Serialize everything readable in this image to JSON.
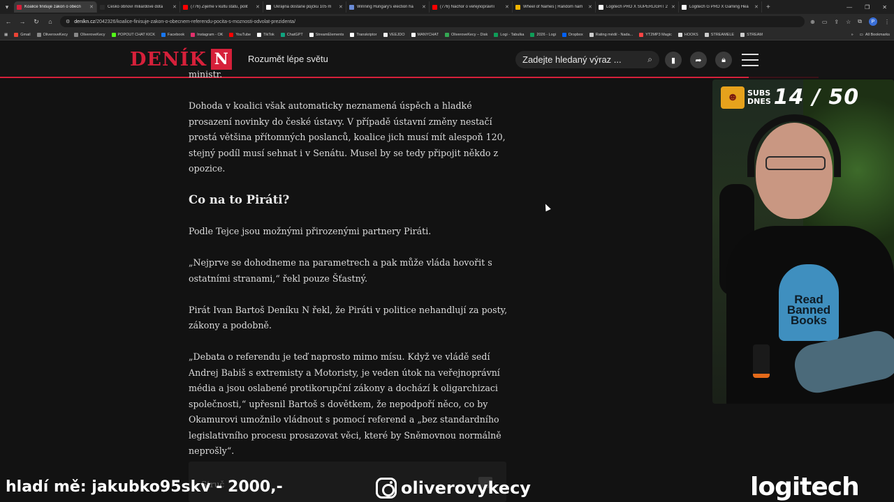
{
  "browser": {
    "tabs": [
      {
        "label": "Koalice finišuje zákon o obecn",
        "color": "#d6203a",
        "active": true
      },
      {
        "label": "Česko obnoví miliardové dota",
        "color": "#2b2b2b",
        "active": false
      },
      {
        "label": "(776) Žijeme v kultu státu, polit",
        "color": "#ff0000",
        "active": false
      },
      {
        "label": "Ukrajina dostane půjčku 105 m",
        "color": "#ffffff",
        "active": false
      },
      {
        "label": "Winning Hungary's election ha",
        "color": "#6a8bd6",
        "active": false
      },
      {
        "label": "(776) Nachor o veřejnoprávní",
        "color": "#ff0000",
        "active": false
      },
      {
        "label": "Wheel of Names | Random nam",
        "color": "#f0b400",
        "active": false
      },
      {
        "label": "Logitech PRO X SUPERLIGHT 2",
        "color": "#ffffff",
        "active": false
      },
      {
        "label": "Logitech G PRO X Gaming Hea",
        "color": "#ffffff",
        "active": false
      }
    ],
    "url_domain": "deníkn.cz",
    "url_path": "/2042326/koalice-finisuje-zakon-o-obecnem-referendu-pocita-s-moznosti-odvolat-prezidenta/",
    "profile_initial": "P",
    "bookmarks": [
      {
        "label": "Gmail",
        "color": "#ea4335"
      },
      {
        "label": "OliveroveKecy",
        "color": "#888888"
      },
      {
        "label": "OliveroveKecy",
        "color": "#888888"
      },
      {
        "label": "POPOUT CHAT KICK",
        "color": "#53fc18"
      },
      {
        "label": "Facebook",
        "color": "#1877f2"
      },
      {
        "label": "Instagram - OK",
        "color": "#e1306c"
      },
      {
        "label": "YouTube",
        "color": "#ff0000"
      },
      {
        "label": "TikTok",
        "color": "#ffffff"
      },
      {
        "label": "ChatGPT",
        "color": "#10a37f"
      },
      {
        "label": "StreamElements",
        "color": "#ffffff"
      },
      {
        "label": "Transkriptor",
        "color": "#ffffff"
      },
      {
        "label": "VEEJDO",
        "color": "#f0f0f0"
      },
      {
        "label": "MANYCHAT",
        "color": "#ffffff"
      },
      {
        "label": "OliveroveKecy – Disk",
        "color": "#34a853"
      },
      {
        "label": "Logi - Tabulka",
        "color": "#0f9d58"
      },
      {
        "label": "2026 - Logi",
        "color": "#0f9d58"
      },
      {
        "label": "Dropbox",
        "color": "#0061ff"
      },
      {
        "label": "Rating médií - Nada...",
        "color": "#cccccc"
      },
      {
        "label": "YT2MP3 Magic",
        "color": "#ff4444"
      },
      {
        "label": "HOOKS",
        "color": "#dddddd"
      },
      {
        "label": "STREAMELE",
        "color": "#cccccc"
      },
      {
        "label": "STREAM",
        "color": "#cccccc"
      }
    ],
    "all_bookmarks": "All Bookmarks"
  },
  "site": {
    "logo_word": "DENÍK",
    "logo_letter": "N",
    "tagline": "Rozumět lépe světu",
    "search_placeholder": "Zadejte hledaný výraz ...",
    "brand_color": "#d6203a",
    "read_progress": 0.915
  },
  "article": {
    "paragraphs": [
      {
        "type": "p",
        "text": "ministr."
      },
      {
        "type": "p",
        "text": "Dohoda v koalici však automaticky neznamená úspěch a hladké prosazení novinky do české ústavy. V případě ústavní změny nestačí prostá většina přítomných poslanců, koalice jich musí mít alespoň 120, stejný podíl musí sehnat i v Senátu. Musel by se tedy připojit někdo z opozice."
      },
      {
        "type": "h2",
        "text": "Co na to Piráti?"
      },
      {
        "type": "p",
        "text": "Podle Tejce jsou možnými přirozenými partnery Piráti."
      },
      {
        "type": "p",
        "text": "„Nejprve se dohodneme na parametrech a pak může vláda hovořit s ostatními stranami,“ řekl pouze Šťastný."
      },
      {
        "type": "p",
        "text": "Pirát Ivan Bartoš Deníku N řekl, že Piráti v politice nehandlují za posty, zákony a podobně."
      },
      {
        "type": "p",
        "text": "„Debata o referendu je teď naprosto mimo mísu. Když ve vládě sedí Andrej Babiš s extremisty a Motoristy, je veden útok na veřejnoprávní média a jsou oslabené protikorupční zákony a dochází k oligarchizaci společnosti,“ upřesnil Bartoš s dovětkem, že nepodpoří něco, co by Okamurovi umožnilo vládnout s pomocí referend a „bez standardního legislativního procesu prosazovat věci, které by Sněmovnou normálně neprošly“."
      }
    ],
    "stub_text": "Struč"
  },
  "webcam": {
    "subs_label_1": "SUBS",
    "subs_label_2": "DNES",
    "subs_count": "14 / 50",
    "shirt_text": "Read Banned Books"
  },
  "overlay": {
    "donation_text": "hladí mě: jakubko95skv - 2000,-",
    "instagram_handle": "oliverovykecy",
    "sponsor": "logitech"
  }
}
